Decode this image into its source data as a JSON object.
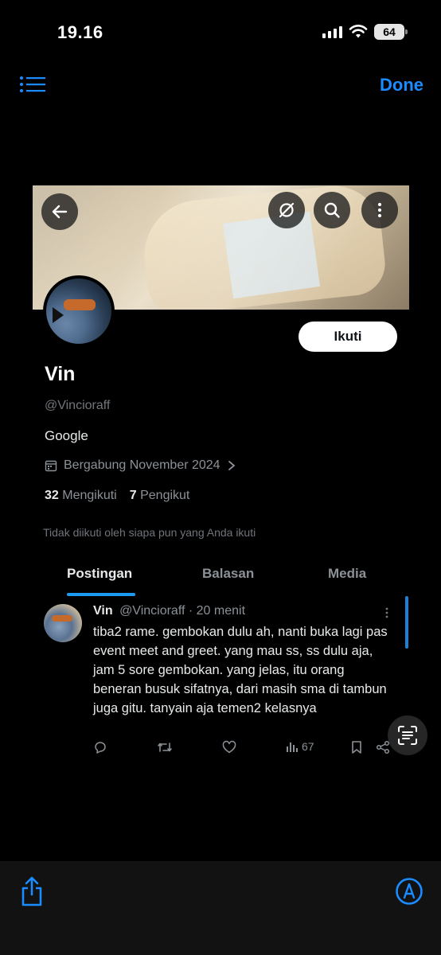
{
  "status_bar": {
    "time": "19.16",
    "battery": "64"
  },
  "viewer": {
    "done_label": "Done"
  },
  "profile": {
    "follow_label": "Ikuti",
    "name": "Vin",
    "handle": "@Vincioraff",
    "bio": "Google",
    "joined": "Bergabung November 2024",
    "following_count": "32",
    "following_label": "Mengikuti",
    "followers_count": "7",
    "followers_label": "Pengikut",
    "mutual_note": "Tidak diikuti oleh siapa pun yang Anda ikuti"
  },
  "tabs": [
    {
      "label": "Postingan",
      "active": true
    },
    {
      "label": "Balasan",
      "active": false
    },
    {
      "label": "Media",
      "active": false
    }
  ],
  "tweet": {
    "author": "Vin",
    "handle": "@Vincioraff",
    "time": "· 20 menit",
    "text": "tiba2 rame. gembokan dulu ah, nanti buka lagi pas event meet and greet. yang mau ss, ss dulu aja, jam 5 sore gembokan. yang jelas, itu orang beneran busuk sifatnya, dari masih sma di tambun juga gitu. tanyain aja temen2 kelasnya",
    "views": "67"
  },
  "colors": {
    "accent": "#1a8cff",
    "tab_indicator": "#1d9bf0",
    "muted_text": "#71767b"
  }
}
